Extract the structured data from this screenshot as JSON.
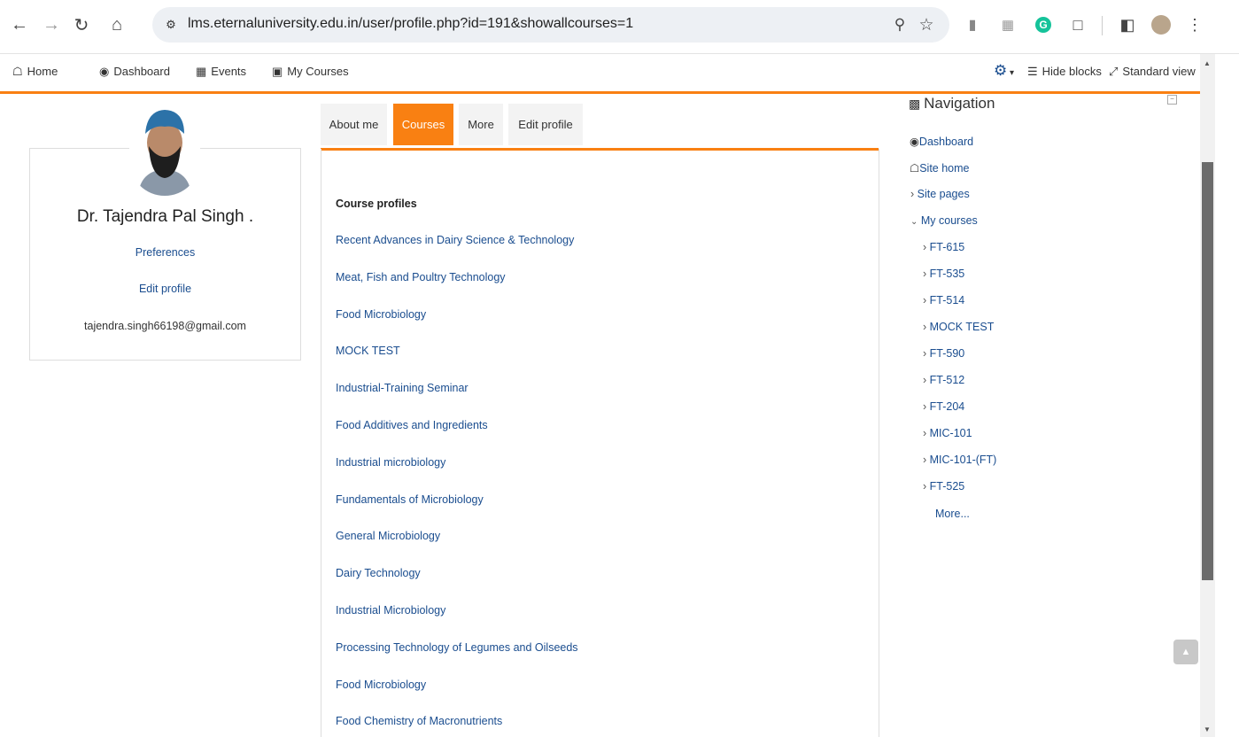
{
  "browser": {
    "url": "lms.eternaluniversity.edu.in/user/profile.php?id=191&showallcourses=1"
  },
  "navbar": {
    "items": [
      {
        "label": "Home",
        "icon": "home-icon"
      },
      {
        "label": "Dashboard",
        "icon": "dashboard-icon"
      },
      {
        "label": "Events",
        "icon": "calendar-icon"
      },
      {
        "label": "My Courses",
        "icon": "briefcase-icon"
      }
    ],
    "hide_blocks": "Hide blocks",
    "standard_view": "Standard view"
  },
  "profile": {
    "name": "Dr. Tajendra Pal Singh .",
    "preferences": "Preferences",
    "edit_profile": "Edit profile",
    "email": "tajendra.singh66198@gmail.com"
  },
  "tabs": [
    {
      "label": "About me"
    },
    {
      "label": "Courses",
      "active": true
    },
    {
      "label": "More"
    },
    {
      "label": "Edit profile"
    }
  ],
  "courses": {
    "heading": "Course profiles",
    "items": [
      "Recent Advances in Dairy Science & Technology",
      "Meat, Fish and Poultry Technology",
      "Food Microbiology",
      "MOCK TEST",
      "Industrial-Training Seminar",
      "Food Additives and Ingredients",
      "Industrial microbiology",
      "Fundamentals of Microbiology",
      "General Microbiology",
      "Dairy Technology",
      "Industrial Microbiology",
      "Processing Technology of Legumes and Oilseeds",
      "Food Microbiology",
      "Food Chemistry of Macronutrients"
    ]
  },
  "navigation": {
    "title": "Navigation",
    "dashboard": "Dashboard",
    "site_home": "Site home",
    "site_pages": "Site pages",
    "my_courses": "My courses",
    "course_codes": [
      "FT-615",
      "FT-535",
      "FT-514",
      "MOCK TEST",
      "FT-590",
      "FT-512",
      "FT-204",
      "MIC-101",
      "MIC-101-(FT)",
      "FT-525"
    ],
    "more": "More..."
  },
  "colors": {
    "accent": "#f98012",
    "link": "#1a4d8f"
  }
}
